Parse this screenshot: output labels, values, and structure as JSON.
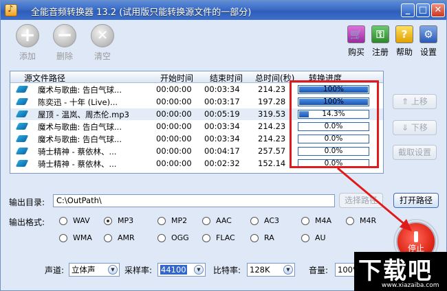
{
  "window": {
    "title": "全能音频转换器 13.2 (试用版只能转换源文件的一部分)",
    "minimize": "_",
    "maximize": "□",
    "close": "✕"
  },
  "toolbar": {
    "add": "添加",
    "delete": "删除",
    "clear": "清空",
    "buy": "购买",
    "register": "注册",
    "help": "帮助",
    "settings": "设置",
    "add_symbol": "+",
    "delete_symbol": "−",
    "clear_symbol": "✕"
  },
  "table": {
    "headers": [
      "源文件路径",
      "开始时间",
      "结束时间",
      "总时间(秒)",
      "转换进度"
    ],
    "rows": [
      {
        "name": "魔术与歌曲: 告白气球...",
        "start": "00:00:00",
        "end": "00:03:34",
        "total": "214.23",
        "progress": 100,
        "progress_label": "100%"
      },
      {
        "name": "陈奕迅 - 十年 (Live)...",
        "start": "00:00:00",
        "end": "00:03:17",
        "total": "197.28",
        "progress": 100,
        "progress_label": "100%"
      },
      {
        "name": "屋顶 - 温岚、周杰伦.mp3",
        "start": "00:00:00",
        "end": "00:05:19",
        "total": "319.53",
        "progress": 14.3,
        "progress_label": "14.3%"
      },
      {
        "name": "魔术与歌曲: 告白气球...",
        "start": "00:00:00",
        "end": "00:03:34",
        "total": "214.23",
        "progress": 0,
        "progress_label": "0.0%"
      },
      {
        "name": "魔术与歌曲: 告白气球...",
        "start": "00:00:00",
        "end": "00:03:34",
        "total": "214.23",
        "progress": 0,
        "progress_label": "0.0%"
      },
      {
        "name": "骑士精神 - 蔡依林、...",
        "start": "00:00:00",
        "end": "00:04:17",
        "total": "257.57",
        "progress": 0,
        "progress_label": "0.0%"
      },
      {
        "name": "骑士精神 - 蔡依林、...",
        "start": "00:00:00",
        "end": "00:02:32",
        "total": "152.14",
        "progress": 0,
        "progress_label": "0.0%"
      }
    ]
  },
  "side": {
    "move_up": "上移",
    "move_down": "下移",
    "cut_settings": "截取设置"
  },
  "output": {
    "dir_label": "输出目录:",
    "dir_value": "C:\\OutPath\\",
    "select_path": "选择路径",
    "open_path": "打开路径",
    "format_label": "输出格式:",
    "formats": [
      "WAV",
      "MP3",
      "MP2",
      "AAC",
      "AC3",
      "M4A",
      "M4R",
      "WMA",
      "AMR",
      "OGG",
      "FLAC",
      "RA",
      "AU"
    ],
    "selected_format": "MP3"
  },
  "stop": {
    "label": "停止"
  },
  "params": {
    "channel_label": "声道:",
    "channel_value": "立体声",
    "samplerate_label": "采样率:",
    "samplerate_value": "44100",
    "bitrate_label": "比特率:",
    "bitrate_value": "128K",
    "volume_label": "音量:",
    "volume_value": "100%"
  },
  "watermark": {
    "text": "下载吧",
    "url": "www.xiazaiba.com"
  },
  "colors": {
    "accent": "#2f5db8",
    "highlight": "#e01a1a",
    "progress": "#1a55b8"
  }
}
